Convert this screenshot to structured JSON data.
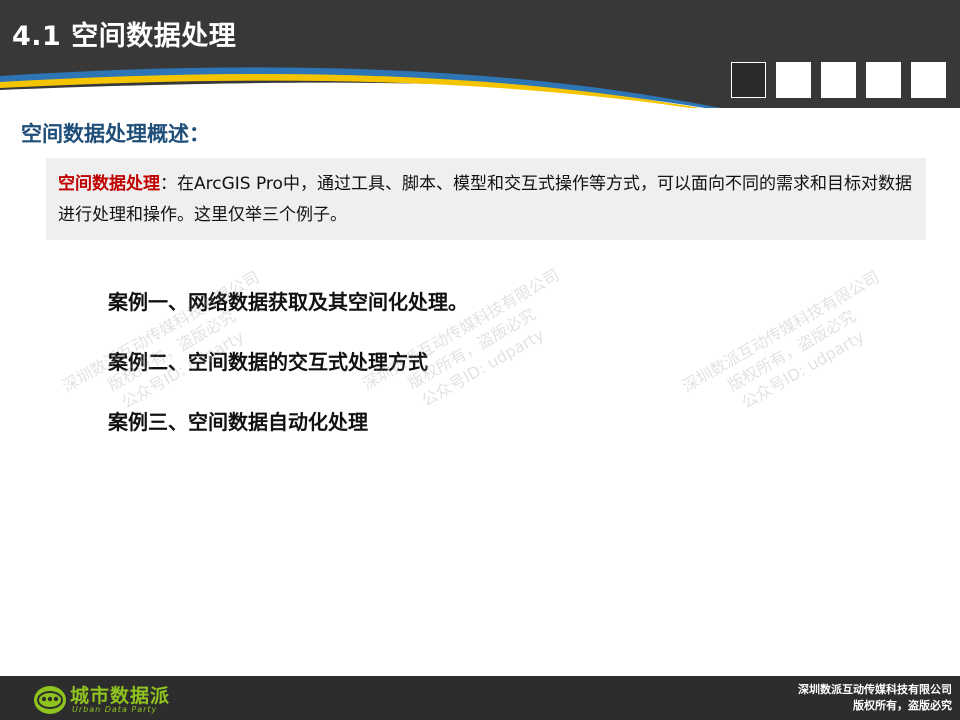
{
  "header": {
    "title": "4.1 空间数据处理",
    "nav_squares": [
      "active",
      "inactive",
      "inactive",
      "inactive",
      "inactive"
    ]
  },
  "section": {
    "subtitle": "空间数据处理概述："
  },
  "summary": {
    "term": "空间数据处理",
    "text": "：在ArcGIS Pro中，通过工具、脚本、模型和交互式操作等方式，可以面向不同的需求和目标对数据进行处理和操作。这里仅举三个例子。"
  },
  "cases": [
    "案例一、网络数据获取及其空间化处理。",
    "案例二、空间数据的交互式处理方式",
    "案例三、空间数据自动化处理"
  ],
  "watermark": {
    "line1": "深圳数派互动传媒科技有限公司",
    "line2": "版权所有，盗版必究",
    "line3": "公众号ID: udparty"
  },
  "footer": {
    "logo_text": "城市数据派",
    "logo_sub": "Urban Data Party",
    "company": "深圳数派互动传媒科技有限公司",
    "rights": "版权所有，盗版必究"
  },
  "colors": {
    "header_bg": "#383838",
    "stripe_blue": "#2e75b6",
    "stripe_yellow": "#f5c400",
    "subtitle": "#1f4e79",
    "term_red": "#c00000",
    "box_bg": "#efefef",
    "footer_bg": "#2d2d2d",
    "logo_green": "#8fc31f"
  }
}
